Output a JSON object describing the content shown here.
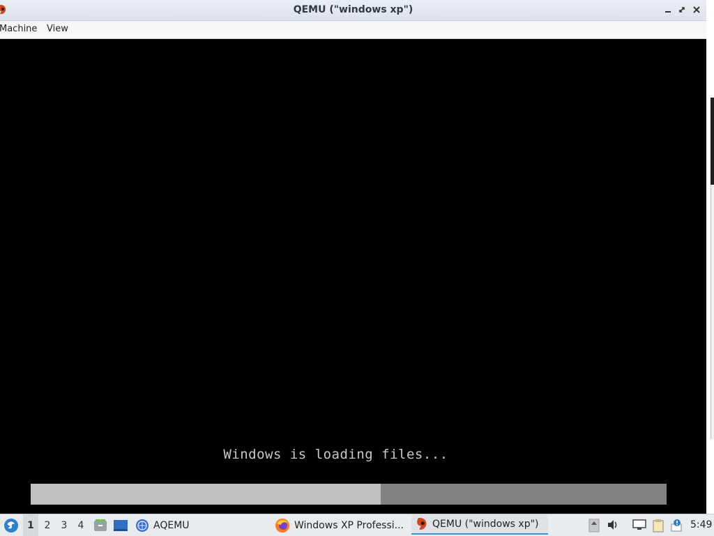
{
  "window": {
    "title": "QEMU (\"windows xp\")",
    "menu": [
      "Machine",
      "View"
    ]
  },
  "guest": {
    "loading_text": "Windows is loading files...",
    "progress": 0.55
  },
  "taskbar": {
    "workspaces": [
      "1",
      "2",
      "3",
      "4"
    ],
    "active_workspace": "1",
    "launchers": [
      "start-menu-icon",
      "file-manager-icon",
      "show-desktop-icon"
    ],
    "tasks": [
      {
        "label": "AQEMU",
        "icon": "aqemu-icon",
        "active": false
      },
      {
        "label": "Windows XP Professi...",
        "icon": "firefox-icon",
        "active": false
      },
      {
        "label": "QEMU (\"windows xp\")",
        "icon": "qemu-icon",
        "active": true
      }
    ],
    "tray": [
      "scroll-up-icon",
      "volume-icon",
      "network-icon",
      "clipboard-icon",
      "update-notifier-icon"
    ],
    "clock": "5:49"
  },
  "colors": {
    "accent": "#3d8fd6",
    "progress_fill": "#c0c0c0",
    "progress_track": "#828282"
  }
}
